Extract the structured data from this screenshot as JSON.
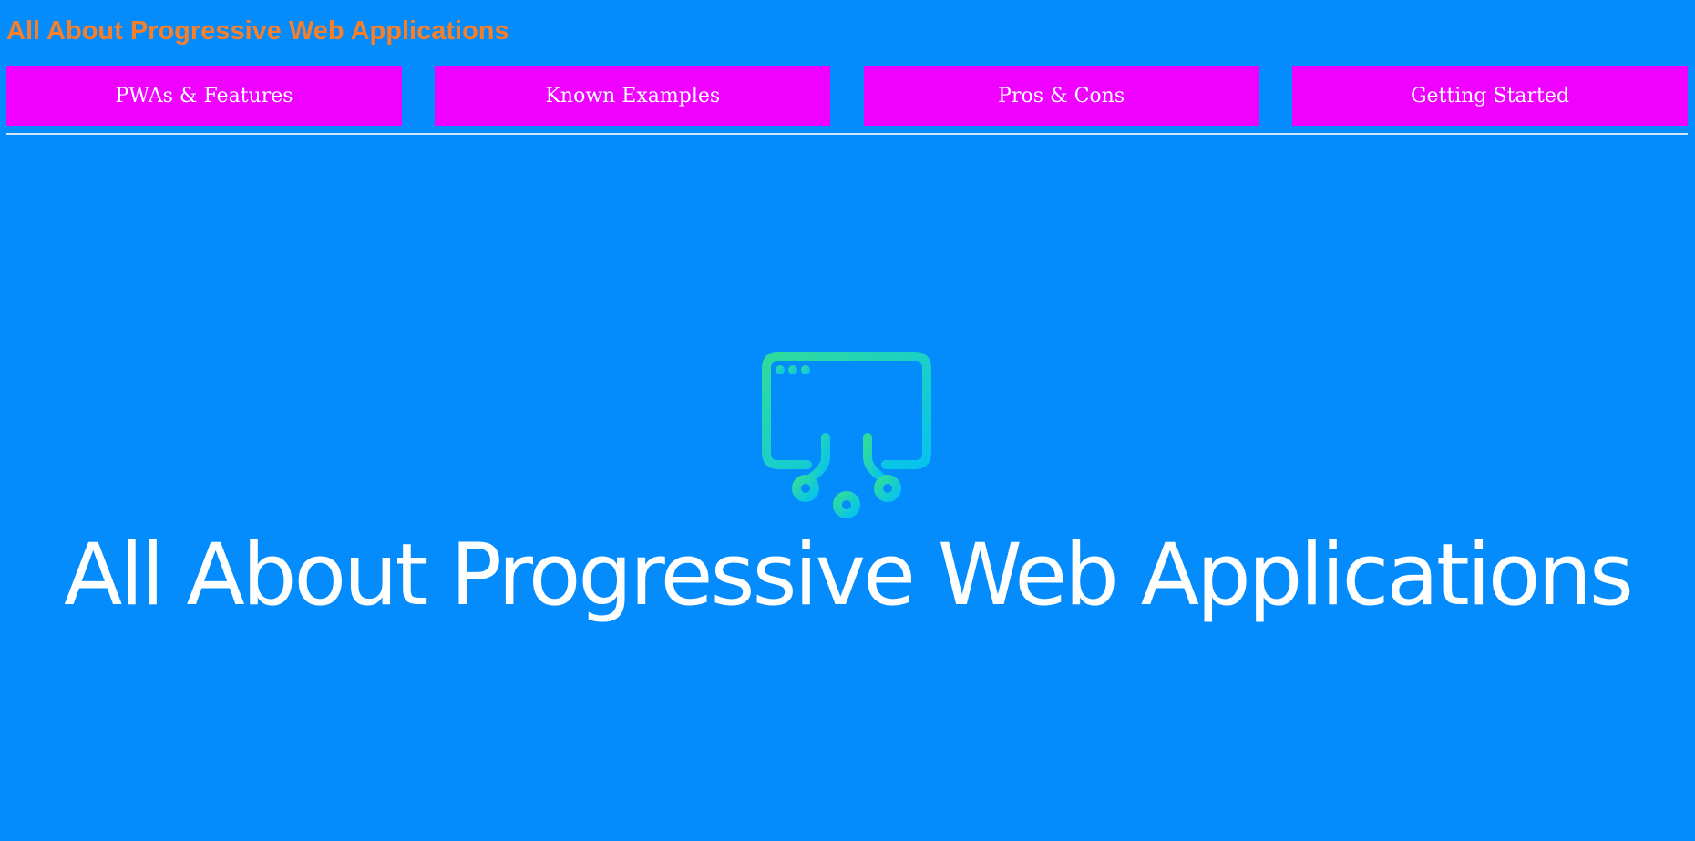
{
  "header": {
    "site_title": "All About Progressive Web Applications"
  },
  "nav": {
    "items": [
      {
        "label": "PWAs & Features"
      },
      {
        "label": "Known Examples"
      },
      {
        "label": "Pros & Cons"
      },
      {
        "label": "Getting Started"
      }
    ]
  },
  "hero": {
    "icon": "web-app-circuit-icon",
    "title": "All About Progressive Web Applications"
  },
  "colors": {
    "background": "#048cfd",
    "site_title": "#f57f2a",
    "nav_button": "#ef00ff",
    "nav_text": "#ffffff",
    "icon_gradient_start": "#2fdc9c",
    "icon_gradient_end": "#06c3ee",
    "hero_text": "#ffffff"
  }
}
